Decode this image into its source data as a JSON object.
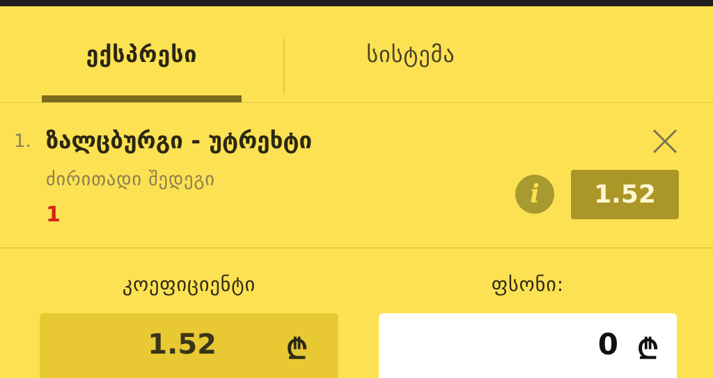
{
  "tabs": [
    {
      "label": "ექსპრესი",
      "active": true
    },
    {
      "label": "სისტემა",
      "active": false
    }
  ],
  "bet": {
    "number": "1.",
    "match": "ზალცბურგი - უტრეხტი",
    "market": "ძირითადი შედეგი",
    "selection": "1",
    "odds": "1.52",
    "info_icon": "info-icon",
    "close_icon": "close-icon"
  },
  "summary": {
    "coefficient_label": "კოეფიციენტი",
    "coefficient_value": "1.52",
    "stake_label": "ფსონი:",
    "stake_value": "0",
    "currency": "₾"
  },
  "colors": {
    "background": "#fce153",
    "accent": "#ab9628",
    "selection": "#d8231c"
  }
}
